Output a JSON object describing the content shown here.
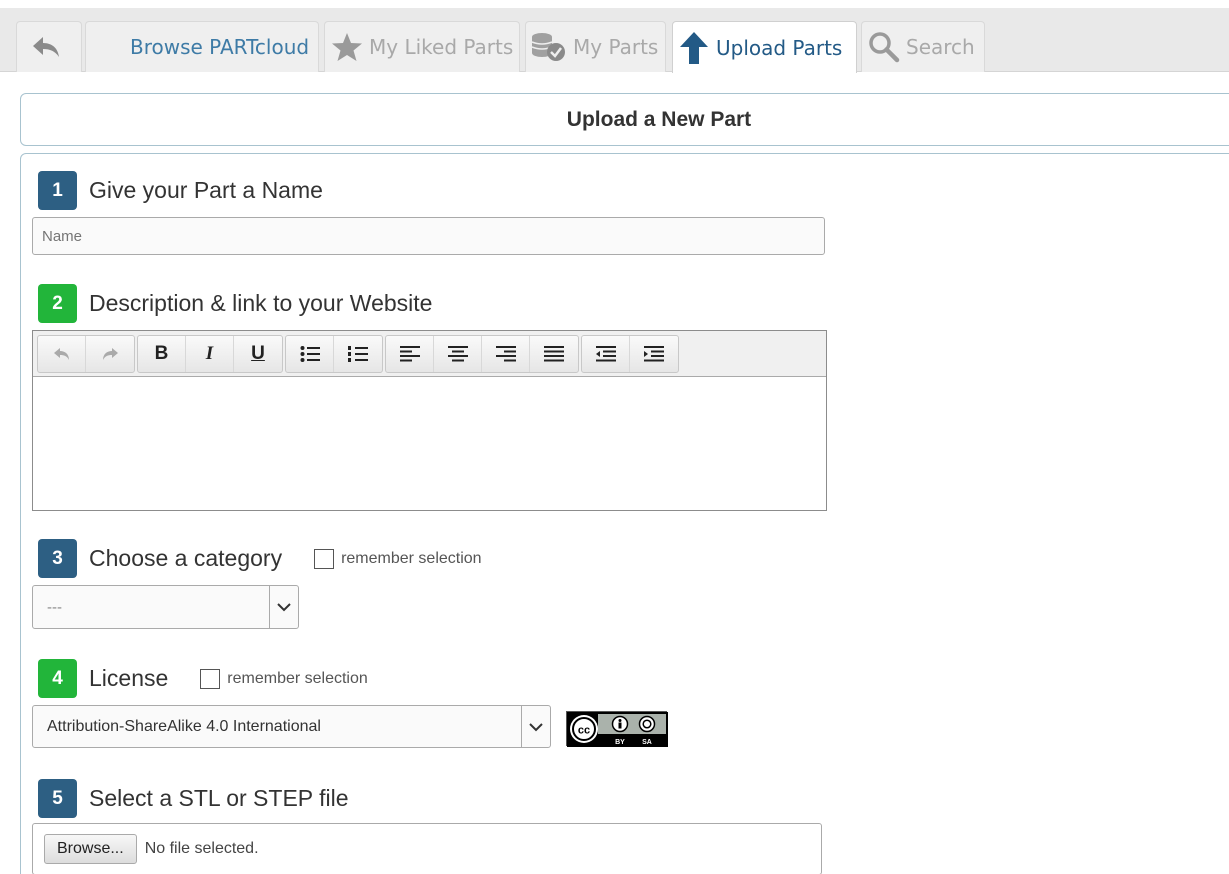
{
  "tabs": {
    "browse": "Browse PARTcloud",
    "liked": "My Liked Parts",
    "myparts": "My Parts",
    "upload": "Upload Parts",
    "search": "Search"
  },
  "header": {
    "title": "Upload a New Part"
  },
  "steps": {
    "name": {
      "number": "1",
      "title": "Give your Part a Name",
      "placeholder": "Name"
    },
    "description": {
      "number": "2",
      "title": "Description & link to your Website"
    },
    "category": {
      "number": "3",
      "title": "Choose a category",
      "remember": "remember selection",
      "selected": "---"
    },
    "license": {
      "number": "4",
      "title": "License",
      "remember": "remember selection",
      "selected": "Attribution-ShareAlike 4.0 International"
    },
    "file": {
      "number": "5",
      "title": "Select a STL or STEP file",
      "browse": "Browse...",
      "status": "No file selected."
    }
  },
  "editor": {
    "bold": "B",
    "italic": "I",
    "underline": "U"
  },
  "license_badge": {
    "cc": "cc",
    "by": "BY",
    "sa": "SA"
  },
  "colors": {
    "step_blue": "#2d5f83",
    "step_green": "#22b53a",
    "accent": "#235a86"
  }
}
